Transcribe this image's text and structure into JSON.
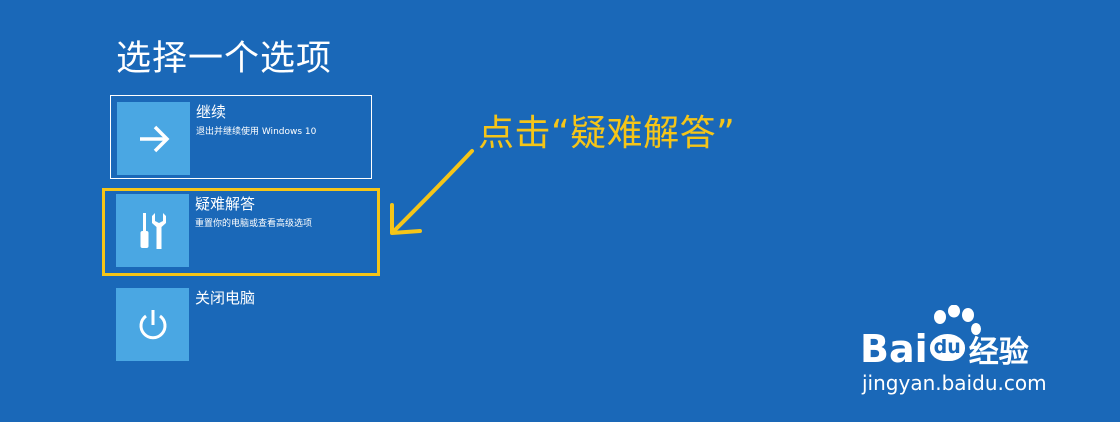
{
  "page": {
    "title": "选择一个选项"
  },
  "options": [
    {
      "icon": "arrow-right-icon",
      "title": "继续",
      "description": "退出并继续使用 Windows 10"
    },
    {
      "icon": "tools-icon",
      "title": "疑难解答",
      "description": "重置你的电脑或查看高级选项"
    },
    {
      "icon": "power-icon",
      "title": "关闭电脑",
      "description": ""
    }
  ],
  "annotation": {
    "text": "点击“疑难解答”",
    "color": "#f5c518"
  },
  "watermark": {
    "logo_prefix": "Bai",
    "logo_du": "du",
    "logo_suffix": "经验",
    "url": "jingyan.baidu.com"
  },
  "colors": {
    "background": "#1a68b8",
    "tile": "#4aa7e3",
    "highlight": "#f5c518"
  }
}
